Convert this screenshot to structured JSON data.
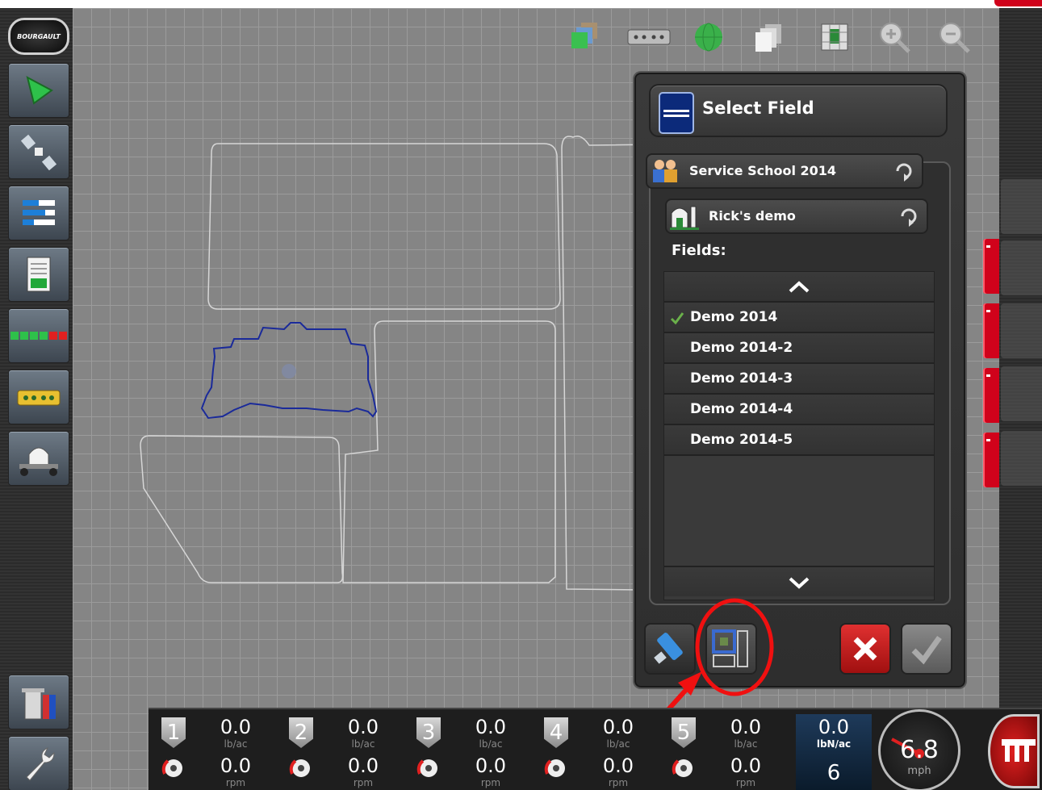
{
  "left_toolbar": {
    "logo_text": "BOURGAULT",
    "buttons": [
      "guidance-icon",
      "gps-satellite-icon",
      "layout-bars-icon",
      "report-icon",
      "sections-icon",
      "implement-icon",
      "planter-icon"
    ],
    "bottom_buttons": [
      "data-trash-icon",
      "settings-wrench-icon"
    ]
  },
  "top_toolbar": [
    "layers-icon",
    "implement-view-icon",
    "globe-icon",
    "pages-icon",
    "field-map-icon",
    "zoom-in-icon",
    "zoom-out-icon"
  ],
  "dialog": {
    "title": "Select Field",
    "client": "Service School 2014",
    "farm": "Rick's demo",
    "fields_label": "Fields:",
    "fields": [
      {
        "name": "Demo 2014",
        "selected": true
      },
      {
        "name": "Demo 2014-2",
        "selected": false
      },
      {
        "name": "Demo 2014-3",
        "selected": false
      },
      {
        "name": "Demo 2014-4",
        "selected": false
      },
      {
        "name": "Demo 2014-5",
        "selected": false
      }
    ]
  },
  "status_bar": {
    "sections": [
      {
        "num": "1",
        "rate": "0.0",
        "rate_unit": "lb/ac",
        "speed": "0.0",
        "speed_unit": "rpm"
      },
      {
        "num": "2",
        "rate": "0.0",
        "rate_unit": "lb/ac",
        "speed": "0.0",
        "speed_unit": "rpm"
      },
      {
        "num": "3",
        "rate": "0.0",
        "rate_unit": "lb/ac",
        "speed": "0.0",
        "speed_unit": "rpm"
      },
      {
        "num": "4",
        "rate": "0.0",
        "rate_unit": "lb/ac",
        "speed": "0.0",
        "speed_unit": "rpm"
      },
      {
        "num": "5",
        "rate": "0.0",
        "rate_unit": "lb/ac",
        "speed": "0.0",
        "speed_unit": "rpm"
      }
    ],
    "nitrogen": {
      "value": "0.0",
      "unit": "lbN/ac",
      "count": "6"
    },
    "speed": {
      "value": "6.8",
      "unit": "mph"
    }
  },
  "colors": {
    "accent_red": "#d0021b",
    "boundary_blue": "#1a2a9a"
  }
}
